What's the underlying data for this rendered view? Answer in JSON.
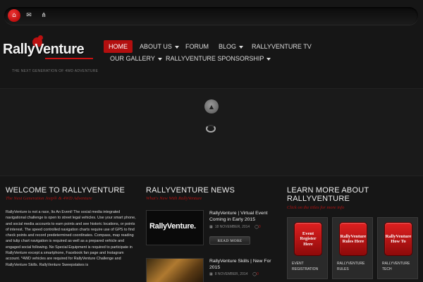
{
  "topbar": {
    "icons": [
      "home-icon",
      "mail-icon",
      "sitemap-icon"
    ],
    "accent": "#b30f0f"
  },
  "logo": {
    "text": "RallyVenture"
  },
  "nav": {
    "row1": [
      {
        "label": "HOME",
        "active": true,
        "dropdown": false
      },
      {
        "label": "ABOUT US",
        "active": false,
        "dropdown": true
      },
      {
        "label": "FORUM",
        "active": false,
        "dropdown": false
      },
      {
        "label": "BLOG",
        "active": false,
        "dropdown": true
      },
      {
        "label": "RALLYVENTURE TV",
        "active": false,
        "dropdown": false
      }
    ],
    "row2": [
      {
        "label": "OUR GALLERY",
        "active": false,
        "dropdown": true
      },
      {
        "label": "RALLYVENTURE SPONSORSHIP",
        "active": false,
        "dropdown": true
      }
    ]
  },
  "tagline": "THE NEXT GENERATION OF 4WD ADVENTURE",
  "slider": {
    "arrow_icon": "chevron-up-icon",
    "loader_icon": "loading-spinner-icon"
  },
  "welcome": {
    "title": "WELCOME TO RALLYVENTURE",
    "subtitle": "The Next Generation Jeep® & 4WD Adventure",
    "body": "RallyVenture is not a race, Its An Event! The social media integrated navigational challenge is open to street legal vehicles. Use your smart phone, and social media accounts to earn points and see historic locations, or points of interest. The speed controlled navigation charts require use of GPS to find check points and record predetermined coordinates. Compass, map reading and tulip chart navigation is required as well as a prepared vehicle and engaged social following. No Special Equipment is required to participate in RallyVenture except a smartphone, Facebook fan page and Instagram account. *4WD vehicles are required for RallyVenture Challenge and RallyVenture Skills. RallyVenture Sweepstakes is"
  },
  "news": {
    "title": "RALLYVENTURE NEWS",
    "subtitle": "What's New With RallyVenture",
    "items": [
      {
        "title": "RallyVenture | Virtual Event Coming in Early 2015",
        "date": "18 NOVEMBER, 2014",
        "comments": "0",
        "read_more": "READ MORE",
        "thumb_text": "RallyVenture."
      },
      {
        "title": "RallyVenture Skills | New For 2015",
        "date": "8 NOVEMBER, 2014",
        "comments": "0"
      }
    ]
  },
  "learn": {
    "title": "LEARN MORE ABOUT RALLYVENTURE",
    "subtitle": "Click on the titles for more info",
    "tiles": [
      {
        "button": "Event Register Here",
        "caption": "EVENT REGISTRATION"
      },
      {
        "button": "RallyVenture Rules Here",
        "caption": "RALLYVENTURE RULES"
      },
      {
        "button": "RallyVenture How To",
        "caption": "RALLYVENTURE TECH"
      }
    ]
  }
}
